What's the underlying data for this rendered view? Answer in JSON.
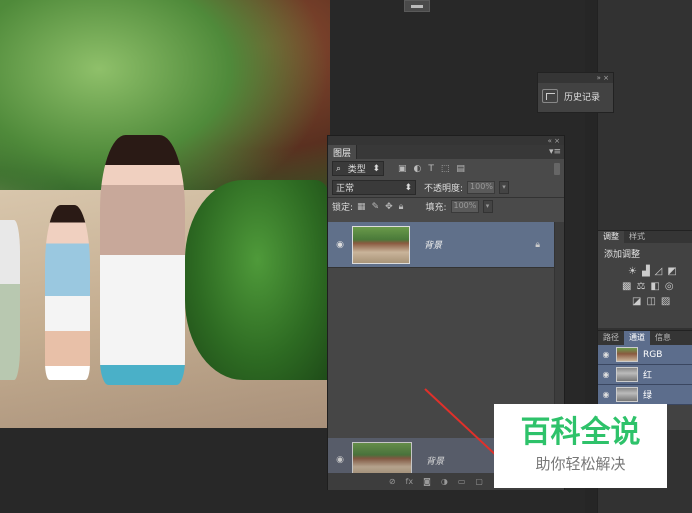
{
  "history_panel": {
    "controls": "»  ×",
    "item_label": "历史记录"
  },
  "layers_panel": {
    "controls": "«  ×",
    "tab": "图层",
    "menu": "▾≡",
    "filter_kind": "类型",
    "blend_mode": "正常",
    "opacity_label": "不透明度:",
    "opacity_value": "100%",
    "lock_label": "锁定:",
    "fill_label": "填充:",
    "fill_value": "100%",
    "layers": [
      {
        "name": "背景",
        "visible": true,
        "locked": true
      }
    ],
    "dragging_layer_name": "背景"
  },
  "adjustments_panel": {
    "tabs": [
      "调整",
      "样式"
    ],
    "title": "添加调整"
  },
  "channels_panel": {
    "tabs": [
      "路径",
      "通道",
      "信息"
    ],
    "active_tab": "通道",
    "channels": [
      {
        "name": "RGB"
      },
      {
        "name": "红"
      },
      {
        "name": "绿"
      }
    ]
  },
  "watermark": {
    "title": "百科全说",
    "subtitle": "助你轻松解决"
  },
  "colors": {
    "selection": "#60708a",
    "arrow": "#e0302a",
    "watermark_green": "#2ec26a"
  }
}
